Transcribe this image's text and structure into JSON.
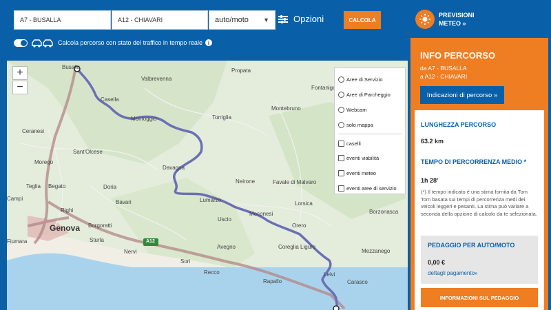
{
  "form": {
    "from_value": "A7 - BUSALLA",
    "to_value": "A12 - CHIAVARI",
    "mode_selected": "auto/moto",
    "options_label": "Opzioni",
    "calc_button": "CALCOLA",
    "weather_label_1": "PREVISIONI",
    "weather_label_2": "METEO »"
  },
  "traffic": {
    "label": "Calcola percorso con stato del traffico in tempo reale"
  },
  "map": {
    "zoom_in": "+",
    "zoom_out": "−",
    "layers": [
      {
        "label": "Aree di Servizio",
        "kind": "radio"
      },
      {
        "label": "Aree di Parcheggio",
        "kind": "radio"
      },
      {
        "label": "Webcam",
        "kind": "radio"
      },
      {
        "label": "solo mappa",
        "kind": "radio"
      },
      {
        "label": "caselli",
        "kind": "check"
      },
      {
        "label": "eventi viabilità",
        "kind": "check"
      },
      {
        "label": "eventi meteo",
        "kind": "check"
      },
      {
        "label": "eventi aree di servizio",
        "kind": "check"
      }
    ],
    "places": {
      "busalla": "Busalla",
      "propata": "Propata",
      "valbrevenna": "Valbrevenna",
      "fontanigorda": "Fontanigo",
      "casella": "Casella",
      "montoggio": "Montoggio",
      "torriglia": "Torriglia",
      "montebruno": "Montebruno",
      "ceranesi": "Ceranesi",
      "santolcese": "Sant'Olcese",
      "morego": "Morego",
      "davagna": "Davagna",
      "neirone": "Neirone",
      "favale": "Favale di Malvaro",
      "teglia": "Teglia",
      "begato": "Begato",
      "doria": "Doria",
      "bavari": "Bavari",
      "righi": "Righi",
      "lumarzo": "Lumarzo",
      "lorsica": "Lorsica",
      "borzonasca": "Borzonasca",
      "genova": "Genova",
      "fiumara": "Fiumara",
      "campi": "Campi",
      "borgoratti": "Borgoratti",
      "uscio": "Uscio",
      "moconesi": "Moconesi",
      "orero": "Orero",
      "sturla": "Sturla",
      "nervi": "Nervi",
      "avegno": "Avegno",
      "coreglia": "Coreglia Ligure",
      "mezzanego": "Mezzanego",
      "sori": "Sori",
      "recco": "Recco",
      "rapallo": "Rapallo",
      "leivi": "Leivi",
      "carasco": "Carasco",
      "a12": "A12"
    }
  },
  "info": {
    "title": "INFO PERCORSO",
    "from": "da A7 - BUSALLA",
    "to": "a A12 - CHIAVARI",
    "directions_button": "Indicazioni di percorso »",
    "length_label": "LUNGHEZZA PERCORSO",
    "length_value": "63.2 km",
    "time_label": "TEMPO DI PERCORRENZA MEDIO *",
    "time_value": "1h 28'",
    "note": "(*) Il tempo indicato è una stima fornita da Tom Tom basata sui tempi di percorrenza medi dei veicoli leggeri e pesanti. La stima può variare a seconda della opzione di calcolo da te selezionata.",
    "toll_label": "PEDAGGIO PER AUTO/MOTO",
    "toll_value": "0,00 €",
    "toll_link": "dettagli pagamento»",
    "toll_button": "INFORMAZIONI SUL PEDAGGIO"
  },
  "colors": {
    "brand_blue": "#0a60a8",
    "accent_orange": "#ef7d22",
    "route": "#6b6fb5"
  }
}
